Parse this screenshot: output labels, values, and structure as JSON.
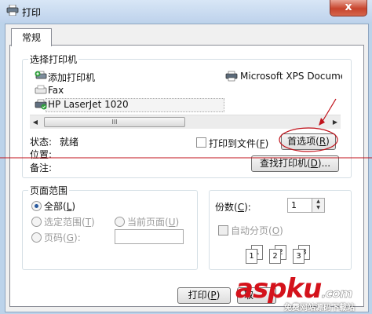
{
  "window": {
    "title": "打印",
    "close_symbol": "x"
  },
  "tabs": [
    {
      "label": "常规"
    }
  ],
  "printer_group": {
    "legend": "选择打印机",
    "printers": [
      {
        "label": "添加打印机",
        "icon": "add-printer-icon"
      },
      {
        "label": "Fax",
        "icon": "fax-icon"
      },
      {
        "label": "HP LaserJet 1020",
        "icon": "default-printer-icon"
      },
      {
        "label": "Microsoft XPS Docume",
        "icon": "printer-icon"
      }
    ],
    "scroll_thumb": "III",
    "status_label": "状态:",
    "status_value": "就绪",
    "location_label": "位置:",
    "comment_label": "备注:",
    "print_to_file_label": "打印到文件",
    "print_to_file_key": "F",
    "preferences_label": "首选项",
    "preferences_key": "R",
    "find_printer_label": "查找打印机",
    "find_printer_key": "D",
    "find_printer_suffix": "..."
  },
  "page_range": {
    "legend": "页面范围",
    "all_label": "全部",
    "all_key": "L",
    "selection_label": "选定范围",
    "selection_key": "T",
    "current_label": "当前页面",
    "current_key": "U",
    "pages_label": "页码",
    "pages_key": "G",
    "pages_value": ""
  },
  "copies": {
    "label": "份数",
    "key": "C",
    "value": "1",
    "collate_label": "自动分页",
    "collate_key": "O",
    "stack_pages": [
      "1",
      "1",
      "2",
      "2",
      "3",
      "3"
    ]
  },
  "footer": {
    "print_label": "打印",
    "print_key": "P",
    "cancel_partial": "取"
  },
  "watermark": {
    "text": "aspku",
    "suffix": ".com",
    "subtitle": "免费网站源码下载站"
  },
  "colors": {
    "annotation_red": "#c0121b",
    "title_bar": "#c4d6ee"
  }
}
